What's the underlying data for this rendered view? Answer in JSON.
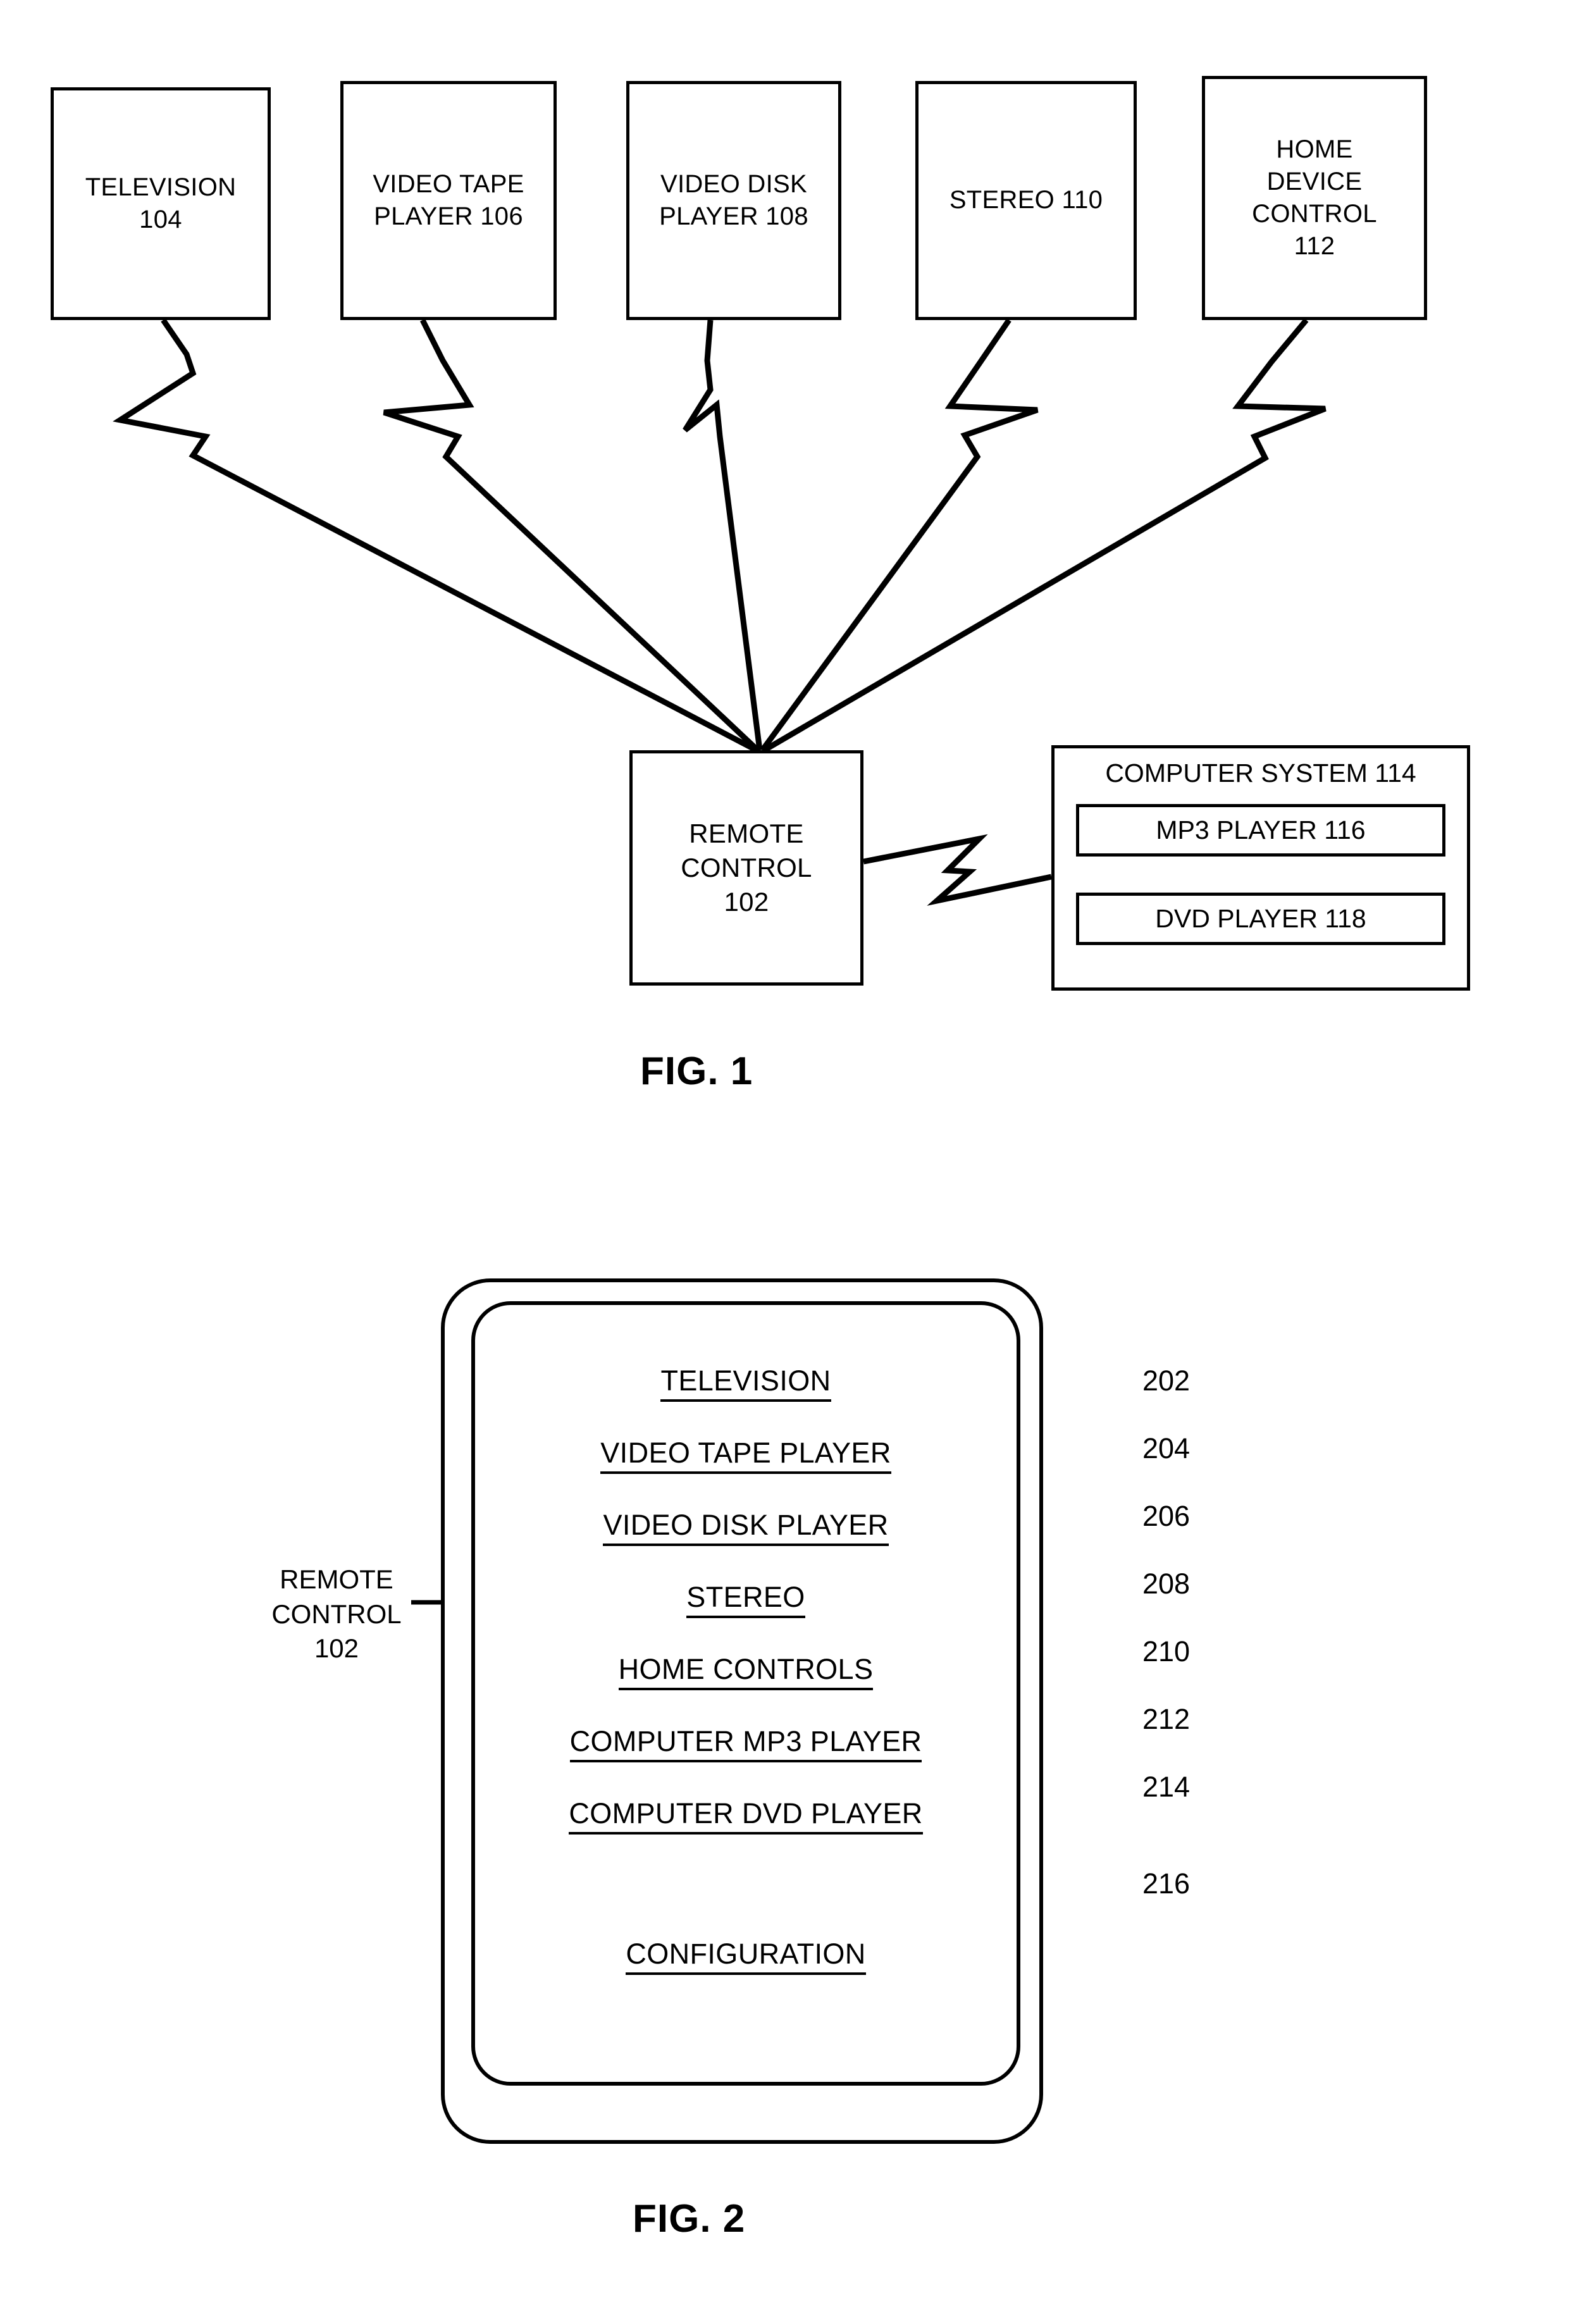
{
  "figures": [
    {
      "caption": "FIG. 1",
      "devices": [
        {
          "lines": [
            "TELEVISION",
            "104"
          ]
        },
        {
          "lines": [
            "VIDEO TAPE",
            "PLAYER 106"
          ]
        },
        {
          "lines": [
            "VIDEO DISK",
            "PLAYER 108"
          ]
        },
        {
          "lines": [
            "STEREO 110"
          ]
        },
        {
          "lines": [
            "HOME",
            "DEVICE",
            "CONTROL",
            "112"
          ]
        }
      ],
      "remote_control": {
        "lines": [
          "REMOTE",
          "CONTROL",
          "102"
        ]
      },
      "computer_system": {
        "title": "COMPUTER SYSTEM 114",
        "components": [
          "MP3 PLAYER 116",
          "DVD PLAYER 118"
        ]
      }
    },
    {
      "caption": "FIG. 2",
      "remote_label": {
        "lines": [
          "REMOTE",
          "CONTROL",
          "102"
        ]
      },
      "menu_items": [
        {
          "label": "TELEVISION",
          "ref": "202"
        },
        {
          "label": "VIDEO TAPE PLAYER",
          "ref": "204"
        },
        {
          "label": "VIDEO DISK PLAYER",
          "ref": "206"
        },
        {
          "label": "STEREO",
          "ref": "208"
        },
        {
          "label": "HOME CONTROLS",
          "ref": "210"
        },
        {
          "label": "COMPUTER MP3 PLAYER",
          "ref": "212"
        },
        {
          "label": "COMPUTER DVD PLAYER",
          "ref": "214"
        },
        {
          "label": "CONFIGURATION",
          "ref": "216"
        }
      ]
    }
  ],
  "fig1": {
    "dev0_line0": "TELEVISION",
    "dev0_line1": "104",
    "dev1_line0": "VIDEO TAPE",
    "dev1_line1": "PLAYER 106",
    "dev2_line0": "VIDEO DISK",
    "dev2_line1": "PLAYER 108",
    "dev3_line0": "STEREO 110",
    "dev4_line0": "HOME",
    "dev4_line1": "DEVICE",
    "dev4_line2": "CONTROL",
    "dev4_line3": "112",
    "rc_line0": "REMOTE",
    "rc_line1": "CONTROL",
    "rc_line2": "102",
    "cs_title": "COMPUTER SYSTEM 114",
    "cs_mp3": "MP3 PLAYER 116",
    "cs_dvd": "DVD PLAYER 118",
    "caption": "FIG. 1"
  },
  "fig2": {
    "caption": "FIG. 2",
    "rc_line0": "REMOTE",
    "rc_line1": "CONTROL",
    "rc_line2": "102",
    "item0": "TELEVISION",
    "item1": "VIDEO TAPE PLAYER",
    "item2": "VIDEO DISK PLAYER",
    "item3": "STEREO",
    "item4": "HOME CONTROLS",
    "item5": "COMPUTER MP3 PLAYER",
    "item6": "COMPUTER DVD PLAYER",
    "item7": "CONFIGURATION",
    "ref0": "202",
    "ref1": "204",
    "ref2": "206",
    "ref3": "208",
    "ref4": "210",
    "ref5": "212",
    "ref6": "214",
    "ref7": "216"
  },
  "colors": {
    "ink": "#000000",
    "paper": "#ffffff"
  }
}
